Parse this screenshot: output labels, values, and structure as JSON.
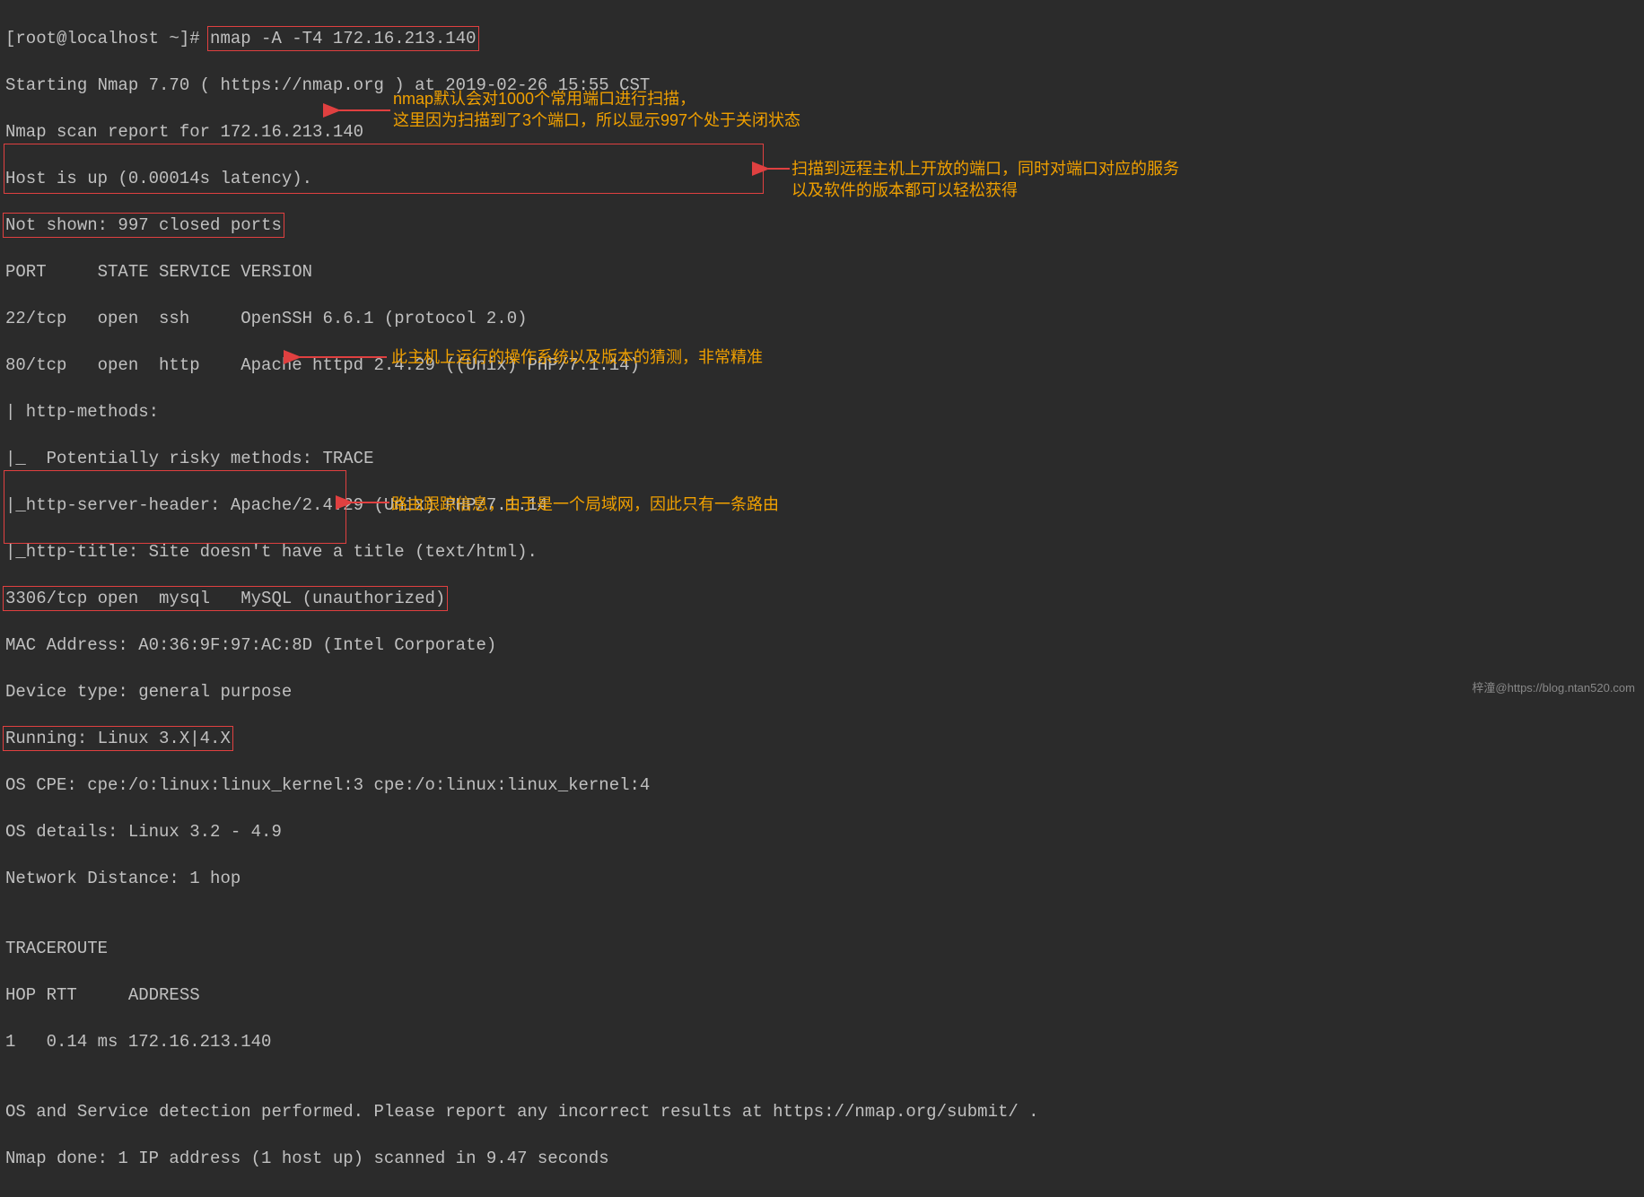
{
  "terminal": {
    "prompt": "[root@localhost ~]# ",
    "command": "nmap -A -T4 172.16.213.140",
    "lines": [
      "Starting Nmap 7.70 ( https://nmap.org ) at 2019-02-26 15:55 CST",
      "Nmap scan report for 172.16.213.140",
      "Host is up (0.00014s latency).",
      "Not shown: 997 closed ports",
      "PORT     STATE SERVICE VERSION",
      "22/tcp   open  ssh     OpenSSH 6.6.1 (protocol 2.0)",
      "80/tcp   open  http    Apache httpd 2.4.29 ((Unix) PHP/7.1.14)",
      "| http-methods:",
      "|_  Potentially risky methods: TRACE",
      "|_http-server-header: Apache/2.4.29 (Unix) PHP/7.1.14",
      "|_http-title: Site doesn't have a title (text/html).",
      "3306/tcp open  mysql   MySQL (unauthorized)",
      "MAC Address: A0:36:9F:97:AC:8D (Intel Corporate)",
      "Device type: general purpose",
      "Running: Linux 3.X|4.X",
      "OS CPE: cpe:/o:linux:linux_kernel:3 cpe:/o:linux:linux_kernel:4",
      "OS details: Linux 3.2 - 4.9",
      "Network Distance: 1 hop",
      "",
      "TRACEROUTE",
      "HOP RTT     ADDRESS",
      "1   0.14 ms 172.16.213.140",
      "",
      "OS and Service detection performed. Please report any incorrect results at https://nmap.org/submit/ .",
      "Nmap done: 1 IP address (1 host up) scanned in 9.47 seconds"
    ]
  },
  "annotations": {
    "a1": "nmap默认会对1000个常用端口进行扫描，\n这里因为扫描到了3个端口，所以显示997个处于关闭状态",
    "a2": "扫描到远程主机上开放的端口，同时对端口对应的服务\n以及软件的版本都可以轻松获得",
    "a3": "此主机上运行的操作系统以及版本的猜测，非常精准",
    "a4": "路由跟踪信息，由于是一个局域网，因此只有一条路由"
  },
  "watermark": "梓潼@https://blog.ntan520.com"
}
